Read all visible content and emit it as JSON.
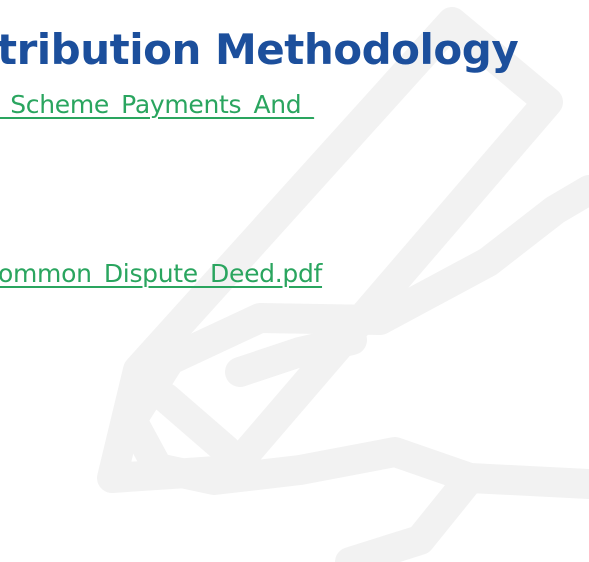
{
  "heading": "tribution Methodology",
  "links": [
    {
      "text": "_Scheme_Payments_And_"
    },
    {
      "text": "ommon_Dispute_Deed.pdf"
    }
  ],
  "watermark": {
    "icon": "pen-hand-icon",
    "color": "#f2f2f2"
  },
  "colors": {
    "heading": "#1c4f9c",
    "link": "#2aa55f"
  }
}
